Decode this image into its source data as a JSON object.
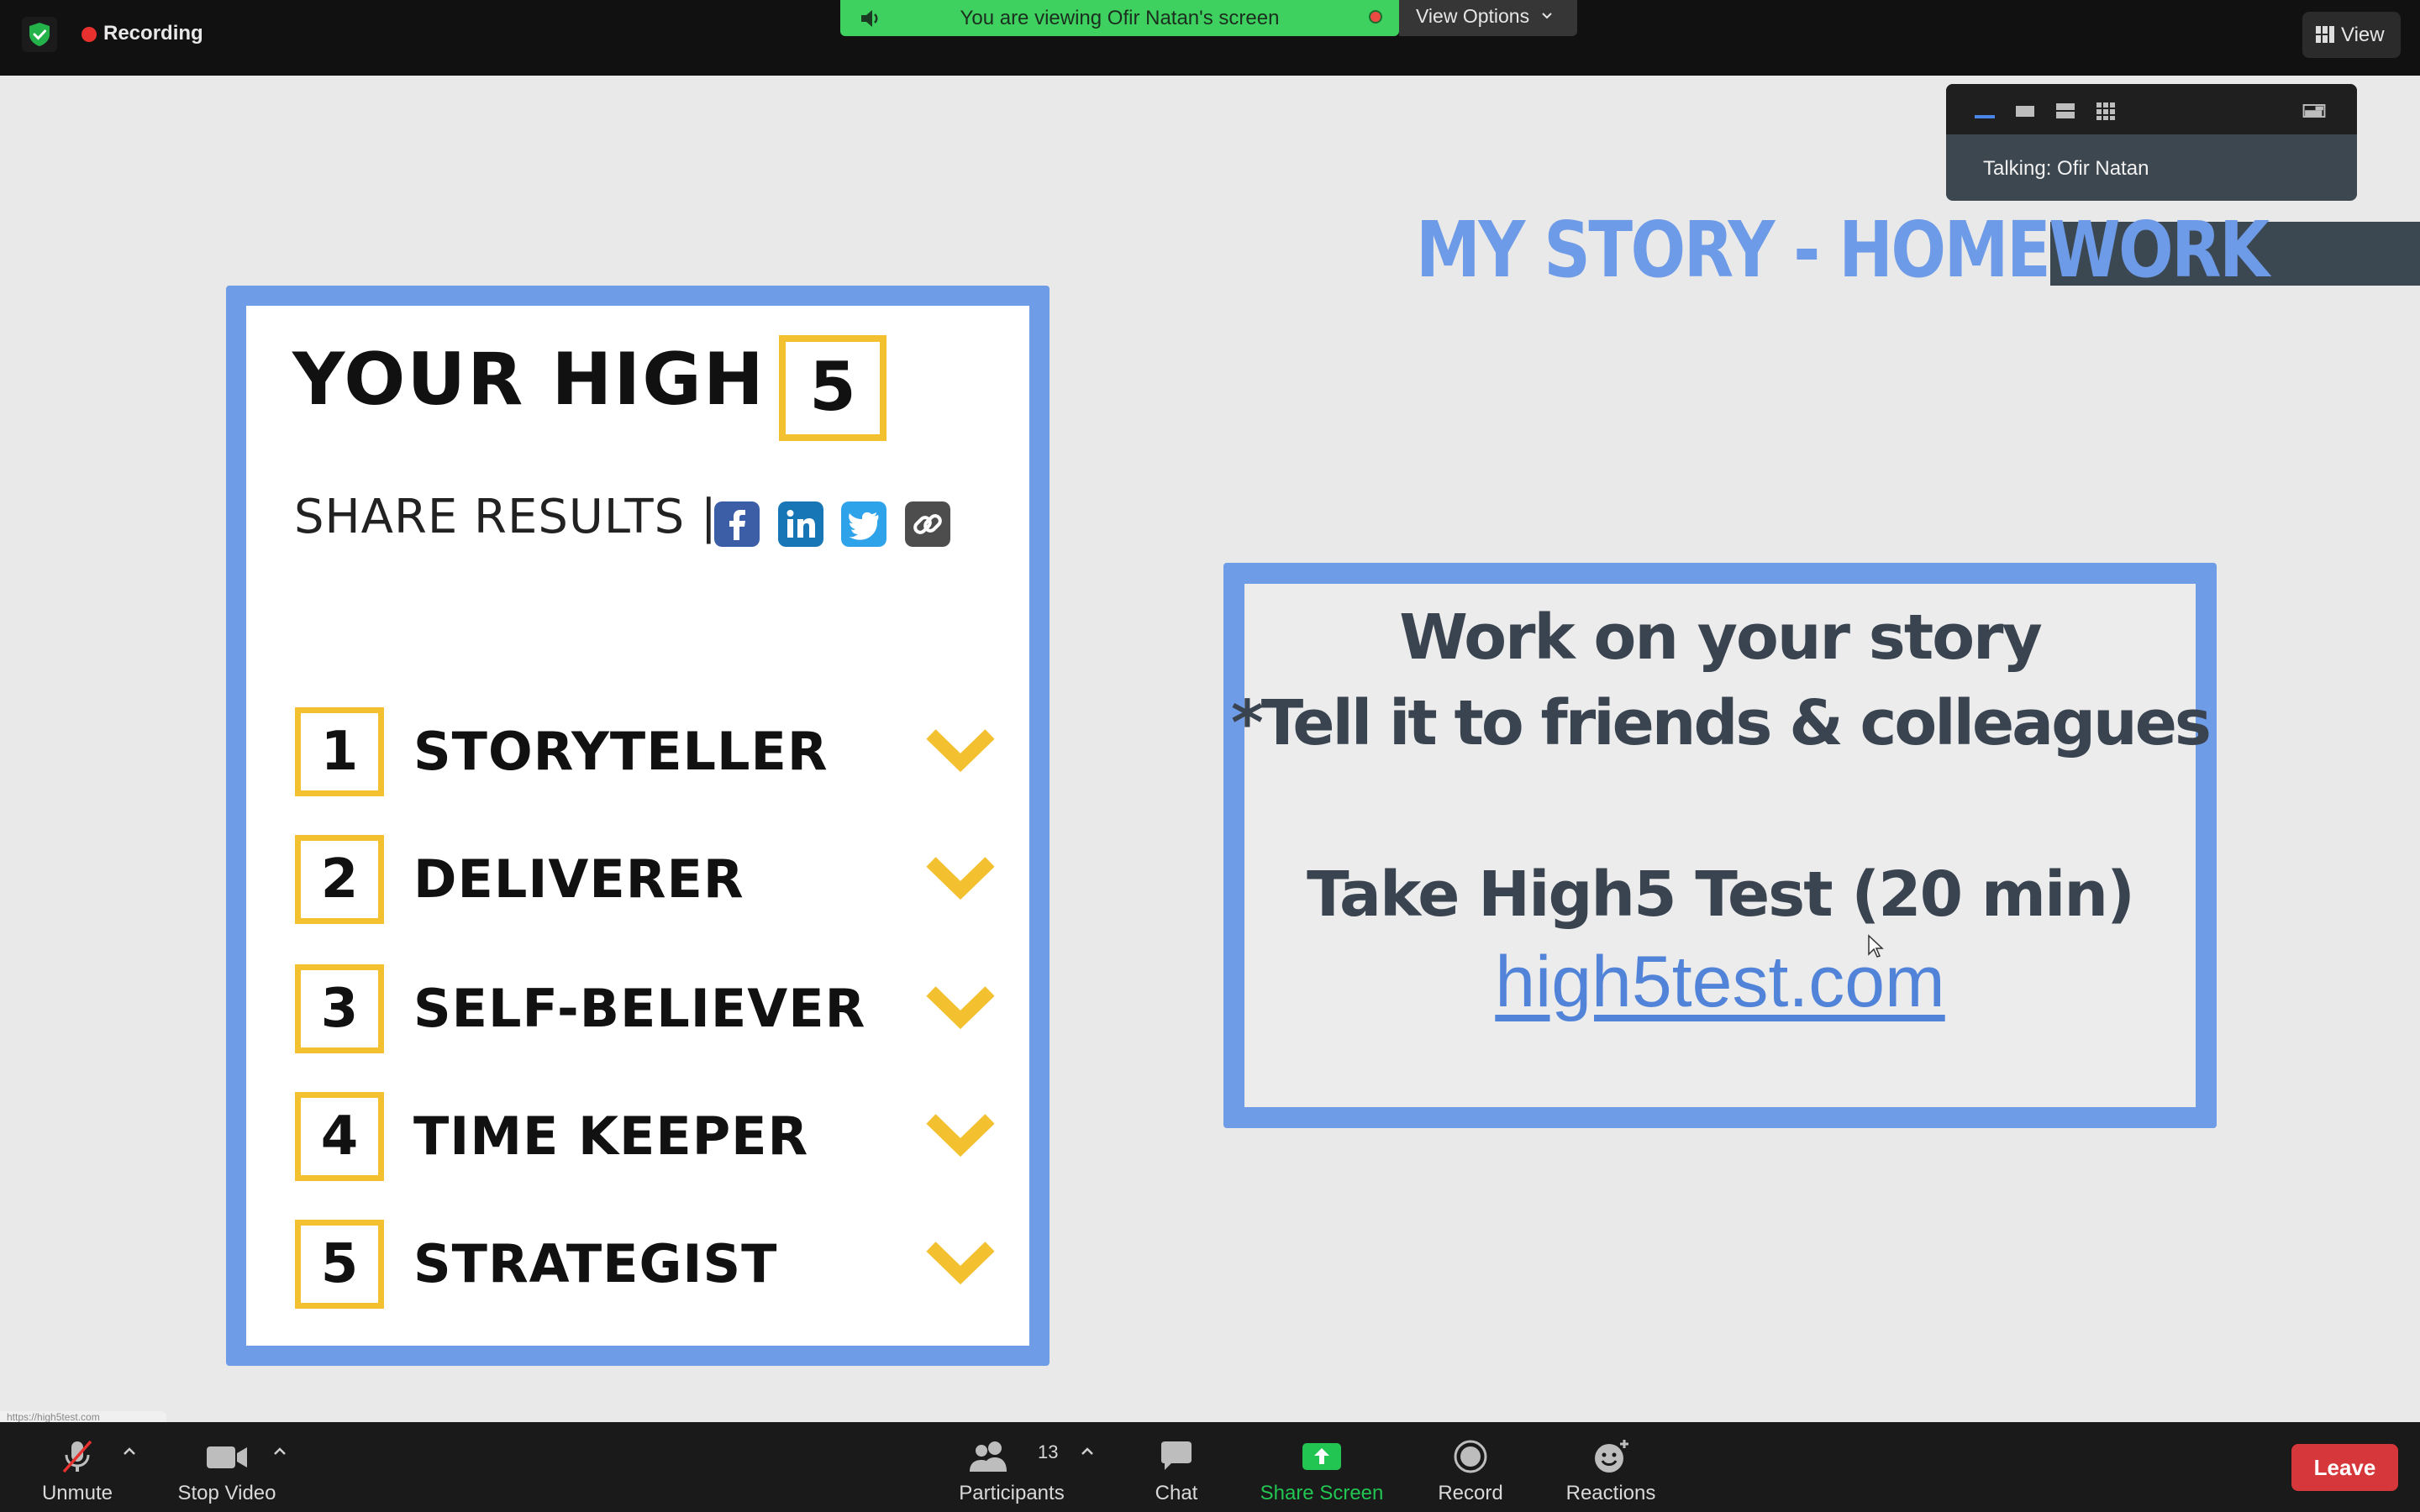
{
  "top_bar": {
    "recording_label": "Recording",
    "share_banner": "You are viewing Ofir Natan's screen",
    "view_options": "View Options",
    "view_button": "View"
  },
  "talking_panel": {
    "talking": "Talking: Ofir Natan"
  },
  "slide": {
    "title": "MY STORY - HOMEWORK",
    "card": {
      "heading": "YOUR HIGH",
      "heading_number": "5",
      "share_results": "SHARE RESULTS |",
      "items": [
        {
          "rank": "1",
          "label": "STORYTELLER"
        },
        {
          "rank": "2",
          "label": "DELIVERER"
        },
        {
          "rank": "3",
          "label": "SELF-BELIEVER"
        },
        {
          "rank": "4",
          "label": "TIME KEEPER"
        },
        {
          "rank": "5",
          "label": "STRATEGIST"
        }
      ]
    },
    "homework": {
      "line1": "Work on your story",
      "line2": "*Tell it to friends & colleagues",
      "line3": "Take High5 Test (20 min)",
      "link": "high5test.com"
    }
  },
  "status_url": "https://high5test.com",
  "toolbar": {
    "unmute": "Unmute",
    "stop_video": "Stop Video",
    "participants": "Participants",
    "participants_count": "13",
    "chat": "Chat",
    "share_screen": "Share Screen",
    "record": "Record",
    "reactions": "Reactions",
    "leave": "Leave"
  },
  "colors": {
    "share_banner": "#3fd15f",
    "slide_blue": "#6f9ce6",
    "high5_yellow": "#f3c02f",
    "share_screen_green": "#23c552",
    "leave_red": "#d5373b",
    "recording_red": "#e8312f"
  }
}
